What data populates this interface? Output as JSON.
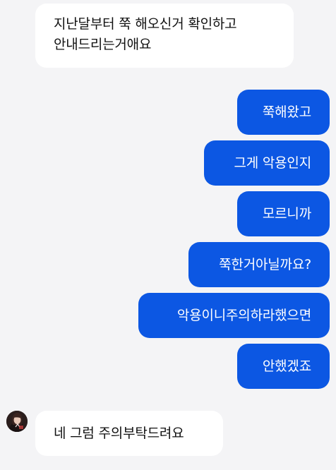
{
  "messages": {
    "incoming_top": {
      "line1": "지난달부터 쭉 해오신거 확인하고",
      "line2": "안내드리는거애요"
    },
    "outgoing": [
      "쭉해왔고",
      "그게 악용인지",
      "모르니까",
      "쭉한거아닐까요?",
      "악용이니주의하라했으면",
      "안했겠죠"
    ],
    "incoming_bottom": "네 그럼 주의부탁드려요"
  },
  "avatar": {
    "icon": "profile-photo-icon"
  },
  "colors": {
    "background": "#f4f4f6",
    "incoming_bubble": "#ffffff",
    "outgoing_bubble": "#0c57e3",
    "outgoing_text": "#ffffff"
  }
}
